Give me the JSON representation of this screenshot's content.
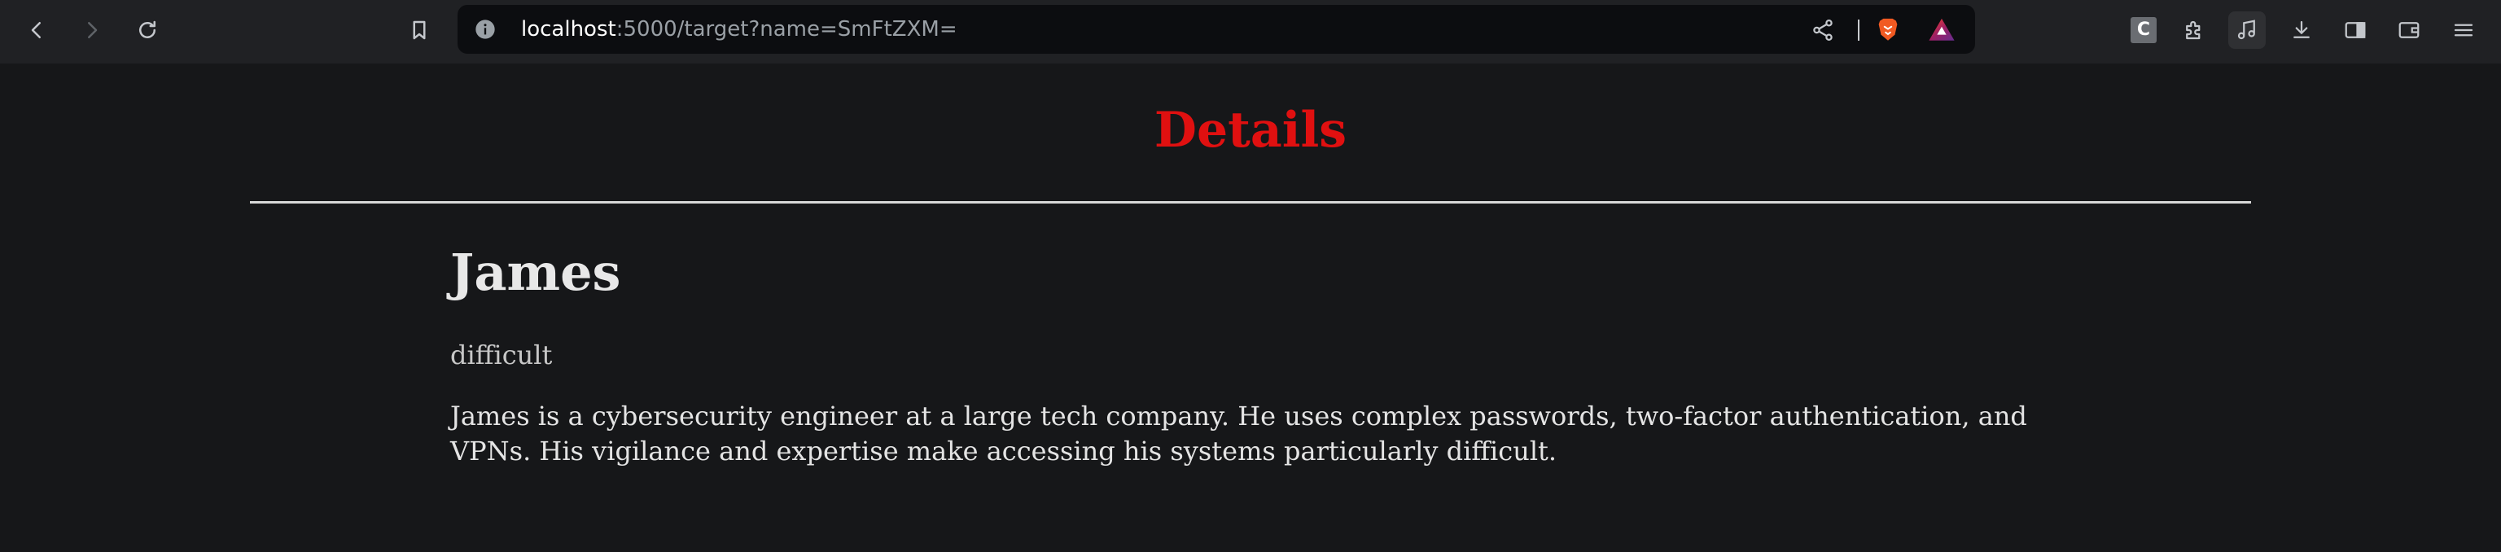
{
  "browser": {
    "url_host": "localhost",
    "url_rest": ":5000/target?name=SmFtZXM=",
    "extension_badge": "C",
    "icons": {
      "back": "chevron-left-icon",
      "forward": "chevron-right-icon",
      "reload": "reload-icon",
      "bookmark": "bookmark-icon",
      "site_info": "info-icon",
      "share": "share-icon",
      "brave_shields": "brave-lion-icon",
      "brave_rewards": "rewards-triangle-icon",
      "extensions": "puzzle-icon",
      "media": "music-note-icon",
      "downloads": "download-icon",
      "sidebar": "sidebar-icon",
      "wallet": "wallet-icon",
      "menu": "hamburger-menu-icon"
    },
    "colors": {
      "toolbar_bg": "#202124",
      "urlbar_bg": "#0c0d10",
      "brave_orange": "#f15a22"
    }
  },
  "page": {
    "heading": "Details",
    "name": "James",
    "difficulty": "difficult",
    "description": "James is a cybersecurity engineer at a large tech company. He uses complex passwords, two-factor authentication, and VPNs. His vigilance and expertise make accessing his systems particularly difficult.",
    "colors": {
      "background": "#161719",
      "heading": "#e01010",
      "text": "#e4e4e4"
    }
  }
}
